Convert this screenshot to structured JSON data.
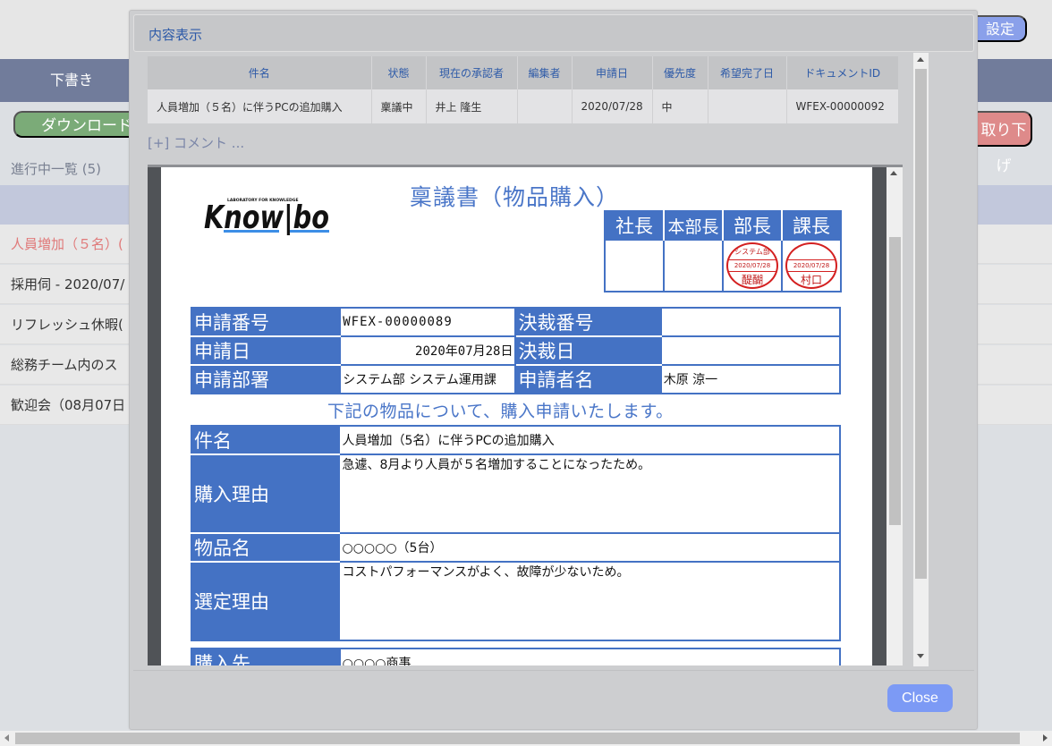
{
  "background": {
    "settings_button": "設定",
    "nav_item": "下書き",
    "download_button": "ダウンロード",
    "withdraw_button": "取り下げ",
    "list_title": "進行中一覧 (5)",
    "rows": [
      {
        "label": "人員増加（５名）(",
        "active": true
      },
      {
        "label": "採用伺 - 2020/07/",
        "active": false
      },
      {
        "label": "リフレッシュ休暇(",
        "active": false
      },
      {
        "label": "総務チーム内のス",
        "active": false
      },
      {
        "label": "歓迎会（08月07日",
        "active": false
      }
    ]
  },
  "modal": {
    "title": "内容表示",
    "info_table": {
      "headers": [
        "件名",
        "状態",
        "現在の承認者",
        "編集者",
        "申請日",
        "優先度",
        "希望完了日",
        "ドキュメントID"
      ],
      "row": [
        "人員増加（５名）に伴うPCの追加購入",
        "稟議中",
        "井上 隆生",
        "",
        "2020/07/28",
        "中",
        "",
        "WFEX-00000092"
      ]
    },
    "comment_link": "[+] コメント ...",
    "close_button": "Close"
  },
  "document": {
    "logo_text": "Know|bo",
    "logo_tagline": "LABORATORY FOR KNOWLEDGE",
    "title": "稟議書（物品購入）",
    "approvers": {
      "headers": [
        "社長",
        "本部長",
        "部長",
        "課長"
      ],
      "stamps": [
        null,
        null,
        {
          "dept": "システム部",
          "date": "2020/07/28",
          "name": "醍醐"
        },
        {
          "dept": "",
          "date": "2020/07/28",
          "name": "村口"
        }
      ]
    },
    "application": {
      "rows": [
        {
          "label1": "申請番号",
          "value1": "WFEX-00000089",
          "label2": "決裁番号",
          "value2": ""
        },
        {
          "label1": "申請日",
          "value1": "2020年07月28日",
          "label2": "決裁日",
          "value2": ""
        },
        {
          "label1": "申請部署",
          "value1": "システム部 システム運用課",
          "label2": "申請者名",
          "value2": "木原 涼一"
        }
      ]
    },
    "subtitle": "下記の物品について、購入申請いたします。",
    "details": [
      {
        "label": "件名",
        "value": "人員増加（5名）に伴うPCの追加購入"
      },
      {
        "label": "購入理由",
        "value": "急遽、8月より人員が５名増加することになったため。"
      },
      {
        "label": "物品名",
        "value": "○○○○○（5台）"
      },
      {
        "label": "選定理由",
        "value": "コストパフォーマンスがよく、故障が少ないため。"
      }
    ],
    "vendor": {
      "label": "購入先",
      "value": "○○○○商事"
    }
  },
  "colors": {
    "accent_blue": "#4472c4",
    "title_blue": "#4a76c8",
    "close_button": "#7c9af5",
    "stamp_red": "#d42020"
  }
}
